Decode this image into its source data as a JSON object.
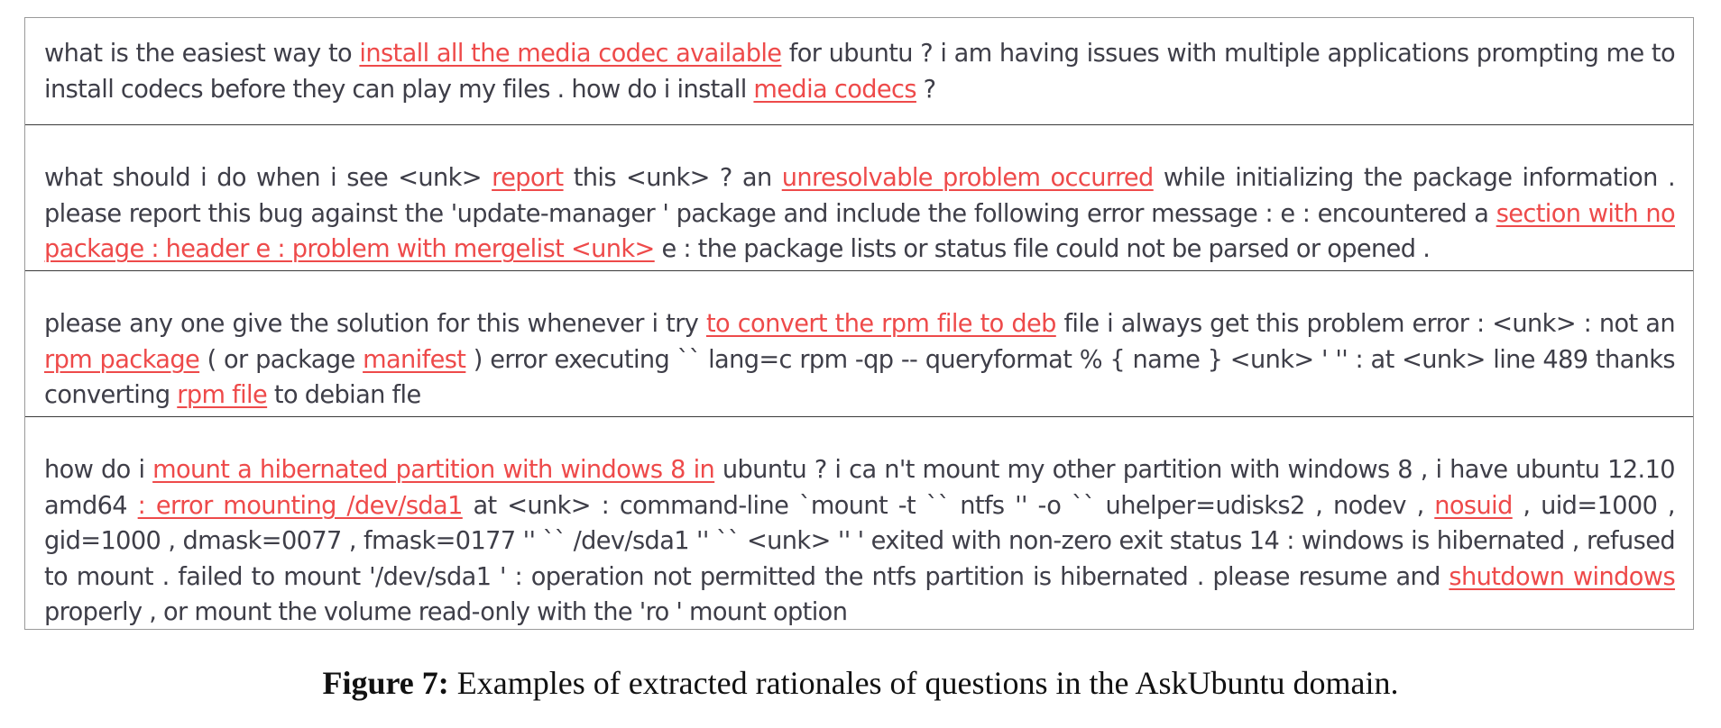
{
  "rows": [
    {
      "segments": [
        {
          "text": "what is the easiest way to ",
          "hl": false
        },
        {
          "text": "install all the media codec available",
          "hl": true
        },
        {
          "text": " for ubuntu ? i am having issues with multiple applications prompting me to install codecs before they can play my files . how do i  install ",
          "hl": false
        },
        {
          "text": "media codecs",
          "hl": true
        },
        {
          "text": " ?",
          "hl": false
        }
      ]
    },
    {
      "segments": [
        {
          "text": "what should i do when i see <unk> ",
          "hl": false
        },
        {
          "text": "report",
          "hl": true
        },
        {
          "text": " this <unk> ? an ",
          "hl": false
        },
        {
          "text": "unresolvable problem occurred",
          "hl": true
        },
        {
          "text": " while initializing the package information . please report this bug against the 'update-manager ' package and include the following error message : e : encountered a ",
          "hl": false
        },
        {
          "text": "section with no package : header e : problem with mergelist <unk>",
          "hl": true
        },
        {
          "text": " e : the package lists or status file could not be parsed or opened .",
          "hl": false
        }
      ]
    },
    {
      "segments": [
        {
          "text": "please any one give the solution for this whenever i try ",
          "hl": false
        },
        {
          "text": "to convert the rpm file to deb",
          "hl": true
        },
        {
          "text": " file i always get this problem error : <unk> : not an ",
          "hl": false
        },
        {
          "text": "rpm package",
          "hl": true
        },
        {
          "text": " ( or package ",
          "hl": false
        },
        {
          "text": "manifest",
          "hl": true
        },
        {
          "text": " ) error executing ``  lang=c rpm -qp -- queryformat % { name } <unk> ' '' : at <unk> line 489 thanks converting ",
          "hl": false
        },
        {
          "text": "rpm file",
          "hl": true
        },
        {
          "text": " to debian fle",
          "hl": false
        }
      ]
    },
    {
      "segments": [
        {
          "text": "how do i ",
          "hl": false
        },
        {
          "text": "mount a hibernated partition with windows 8 in",
          "hl": true
        },
        {
          "text": " ubuntu ? i ca n't mount my other partition with windows 8 , i have ubuntu 12.10 amd64 ",
          "hl": false
        },
        {
          "text": ": error mounting /dev/sda1",
          "hl": true
        },
        {
          "text": " at <unk> : command-line `mount -t `` ntfs '' -o `` uhelper=udisks2 , nodev , ",
          "hl": false
        },
        {
          "text": "nosuid",
          "hl": true
        },
        {
          "text": " , uid=1000 , gid=1000 , dmask=0077 , fmask=0177 '' `` /dev/sda1 '' `` <unk> '' ' exited with non-zero exit status 14 : windows is hibernated , refused to mount . failed to mount '/dev/sda1 ' : operation not permitted the ntfs partition is hibernated . please resume and ",
          "hl": false
        },
        {
          "text": "shutdown windows",
          "hl": true
        },
        {
          "text": " properly , or mount the volume read-only with the 'ro ' mount option",
          "hl": false
        }
      ]
    }
  ],
  "caption": {
    "label": "Figure 7:",
    "text": " Examples of extracted rationales of questions in the AskUbuntu domain."
  },
  "colors": {
    "highlight": "#ee4a4a",
    "text": "#3e3e48",
    "border": "#9a9a9a"
  }
}
